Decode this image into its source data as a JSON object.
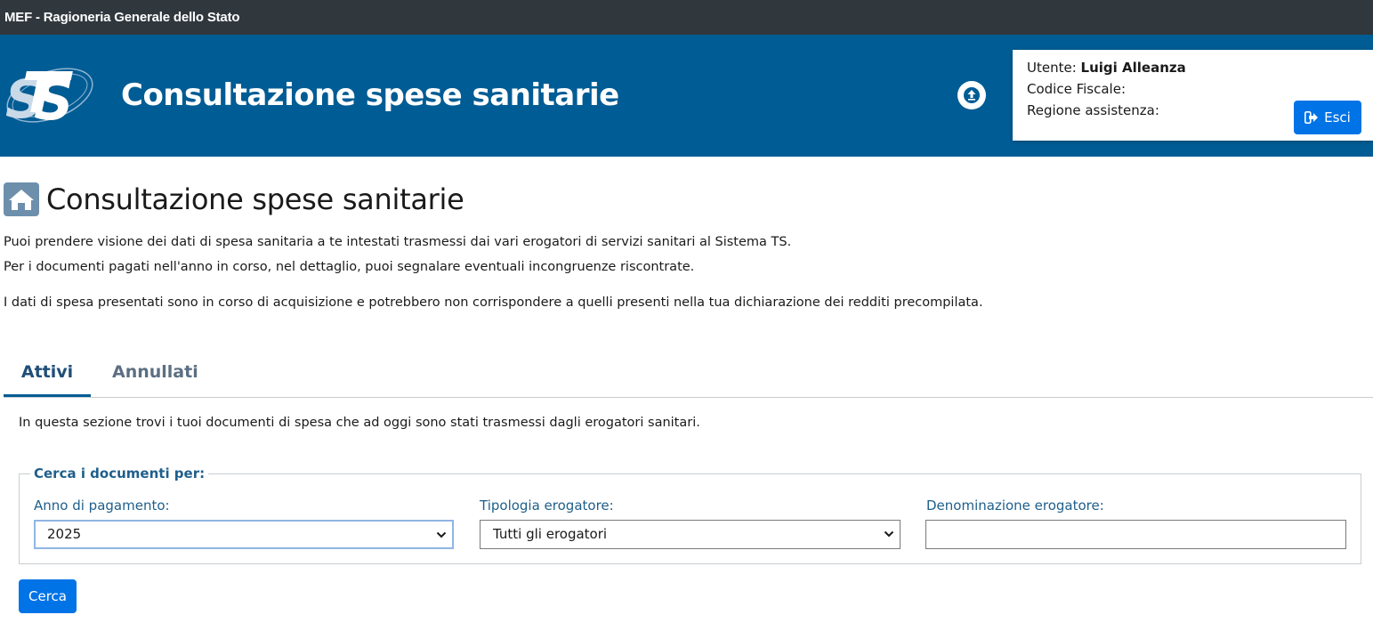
{
  "topbar": {
    "title": "MEF - Ragioneria Generale dello Stato"
  },
  "header": {
    "app_title": "Consultazione spese sanitarie",
    "logo_alt": "TS"
  },
  "user": {
    "utente_label": "Utente:",
    "utente_name": "Luigi Alleanza",
    "codice_fiscale_label": "Codice Fiscale:",
    "regione_label": "Regione assistenza:",
    "esci_label": "Esci"
  },
  "page": {
    "title": "Consultazione spese sanitarie",
    "intro1": "Puoi prendere visione dei dati di spesa sanitaria a te intestati trasmessi dai vari erogatori di servizi sanitari al Sistema TS.",
    "intro2": "Per i documenti pagati nell'anno in corso, nel dettaglio, puoi segnalare eventuali incongruenze riscontrate.",
    "intro3": "I dati di spesa presentati sono in corso di acquisizione e potrebbero non corrispondere a quelli presenti nella tua dichiarazione dei redditi precompilata."
  },
  "tabs": [
    {
      "label": "Attivi",
      "active": true
    },
    {
      "label": "Annullati",
      "active": false
    }
  ],
  "panel": {
    "description": "In questa sezione trovi i tuoi documenti di spesa che ad oggi sono stati trasmessi dagli erogatori sanitari.",
    "legend": "Cerca i documenti per:",
    "anno_label": "Anno di pagamento:",
    "anno_value": "2025",
    "tipologia_label": "Tipologia erogatore:",
    "tipologia_value": "Tutti gli erogatori",
    "denominazione_label": "Denominazione erogatore:",
    "denominazione_value": "",
    "cerca_label": "Cerca"
  },
  "colors": {
    "header_bg": "#005c94",
    "topbar_bg": "#30373d",
    "primary_button": "#0073e6",
    "label_blue": "#1f5f8b"
  },
  "icons": [
    "ts-logo",
    "upload-icon",
    "sign-out-icon",
    "home-icon",
    "chevron-down-icon"
  ]
}
